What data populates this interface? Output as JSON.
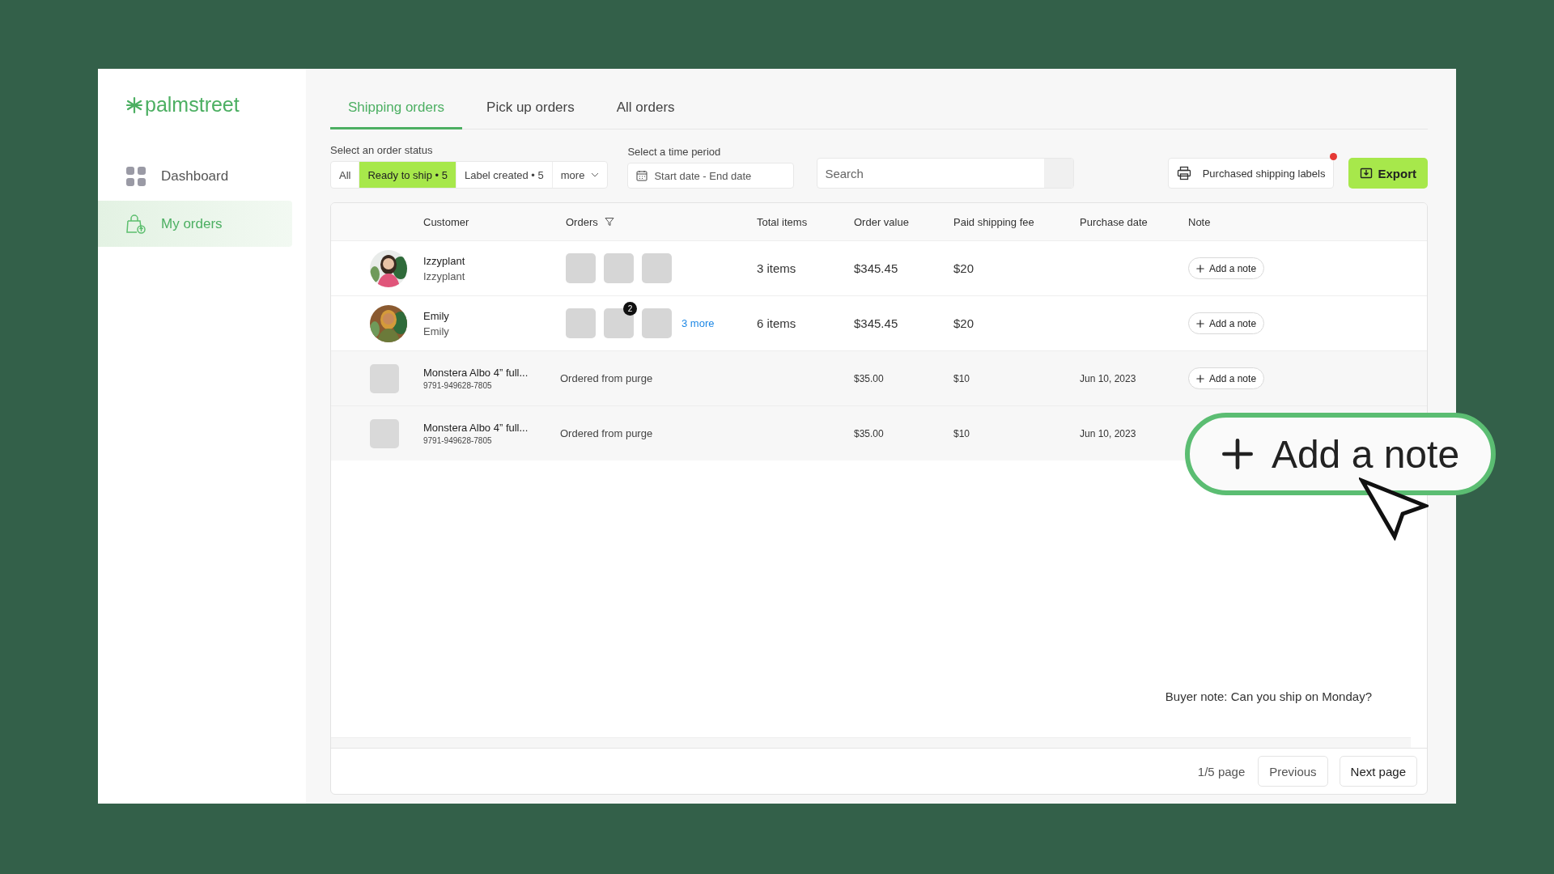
{
  "brand": "palmstreet",
  "sidebar": {
    "items": [
      {
        "label": "Dashboard",
        "selected": false
      },
      {
        "label": "My orders",
        "selected": true
      }
    ]
  },
  "tabs": [
    {
      "label": "Shipping orders",
      "selected": true
    },
    {
      "label": "Pick up orders",
      "selected": false
    },
    {
      "label": "All orders",
      "selected": false
    }
  ],
  "status_filter": {
    "label": "Select an order status",
    "options": [
      {
        "label": "All",
        "selected": false
      },
      {
        "label": "Ready to ship • 5",
        "selected": true
      },
      {
        "label": "Label created • 5",
        "selected": false
      }
    ],
    "more": "more"
  },
  "time_filter": {
    "label": "Select a time period",
    "placeholder": "Start date - End date"
  },
  "search": {
    "placeholder": "Search"
  },
  "labels_button": {
    "label": "Purchased shipping labels",
    "alert": true
  },
  "export_button": {
    "label": "Export"
  },
  "table": {
    "columns": [
      {
        "label": "Customer",
        "filter": false
      },
      {
        "label": "Orders",
        "filter": true
      },
      {
        "label": "Total items",
        "filter": false
      },
      {
        "label": "Order value",
        "filter": false
      },
      {
        "label": "Paid shipping fee",
        "filter": false
      },
      {
        "label": "Purchase date",
        "filter": false
      },
      {
        "label": "Note",
        "filter": false
      }
    ],
    "rows": [
      {
        "kind": "customer",
        "name": "Izzyplant",
        "username": "Izzyplant",
        "avatar": {
          "kind": "picture"
        },
        "thumbnails": [
          {
            "kind": "plain"
          },
          {
            "kind": "plain"
          },
          {
            "kind": "plain"
          }
        ],
        "total_items": "3 items",
        "order_value": "$345.45",
        "shipping_fee": "$20",
        "note_button": "Add a note"
      },
      {
        "kind": "customer",
        "name": "Emily",
        "username": "Emily",
        "avatar": {
          "kind": "picture"
        },
        "thumbnails": [
          {
            "kind": "plain"
          },
          {
            "kind": "badged",
            "badge": "2"
          },
          {
            "kind": "plain"
          }
        ],
        "more": "3 more",
        "total_items": "6 items",
        "order_value": "$345.45",
        "shipping_fee": "$20",
        "note_button": "Add a note"
      },
      {
        "kind": "product",
        "title": "Monstera Albo 4” full...",
        "sku": "9791-949628-7805",
        "description": "Ordered from purge",
        "order_value": "$35.00",
        "shipping_fee": "$10",
        "purchase_date": "Jun 10, 2023",
        "note_button": "Add a note"
      },
      {
        "kind": "product",
        "title": "Monstera Albo 4” full...",
        "sku": "9791-949628-7805",
        "description": "Ordered from purge",
        "order_value": "$35.00",
        "shipping_fee": "$10",
        "purchase_date": "Jun 10, 2023"
      }
    ]
  },
  "buyer_note": "Buyer note: Can you ship on Monday?",
  "pagination": {
    "page": "1/5 page",
    "previous": "Previous",
    "next": "Next page"
  },
  "callout": {
    "label": "Add a note"
  }
}
